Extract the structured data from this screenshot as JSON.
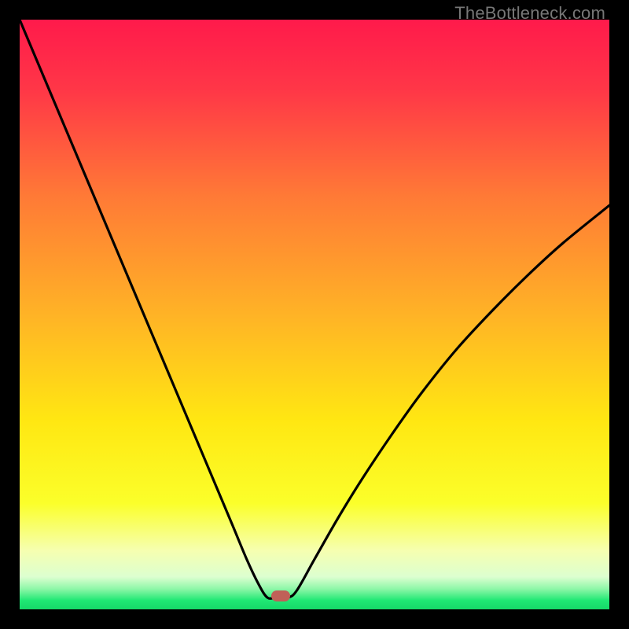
{
  "watermark": "TheBottleneck.com",
  "chart_data": {
    "type": "line",
    "title": "",
    "xlabel": "",
    "ylabel": "",
    "xlim": [
      0,
      100
    ],
    "ylim": [
      0,
      100
    ],
    "grid": false,
    "gradient_stops": [
      {
        "offset": 0.0,
        "color": "#ff1a4b"
      },
      {
        "offset": 0.12,
        "color": "#ff3747"
      },
      {
        "offset": 0.3,
        "color": "#ff7a36"
      },
      {
        "offset": 0.5,
        "color": "#ffb326"
      },
      {
        "offset": 0.68,
        "color": "#ffe712"
      },
      {
        "offset": 0.82,
        "color": "#fbff2a"
      },
      {
        "offset": 0.9,
        "color": "#f6ffb0"
      },
      {
        "offset": 0.945,
        "color": "#dcffd0"
      },
      {
        "offset": 0.965,
        "color": "#8ff7a8"
      },
      {
        "offset": 0.985,
        "color": "#1fe874"
      },
      {
        "offset": 1.0,
        "color": "#16d868"
      }
    ],
    "series": [
      {
        "name": "bottleneck-curve",
        "x": [
          0.0,
          4,
          8,
          12,
          16,
          20,
          24,
          28,
          32,
          36,
          38.5,
          40.5,
          42,
          43.5,
          45.5,
          47,
          50,
          54,
          58,
          63,
          68,
          74,
          80,
          86,
          92,
          100
        ],
        "y": [
          100,
          90.5,
          81,
          71.5,
          62,
          52.5,
          43,
          33.5,
          24,
          14.5,
          8.5,
          4.3,
          2.0,
          2.0,
          2.0,
          3.2,
          8.5,
          15.5,
          22.0,
          29.5,
          36.5,
          44.0,
          50.5,
          56.5,
          62.0,
          68.5
        ]
      }
    ],
    "marker": {
      "x": 44.2,
      "y": 2.3,
      "color": "#c06058"
    }
  }
}
